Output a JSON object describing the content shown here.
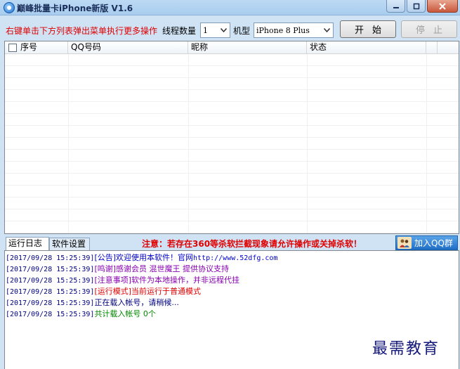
{
  "window": {
    "title": "巅峰批量卡iPhone新版 V1.6",
    "icon": "app-logo-icon"
  },
  "toolbar": {
    "hint": "右键单击下方列表弹出菜单执行更多操作",
    "threads_label": "线程数量",
    "threads_value": "1",
    "model_label": "机型",
    "model_value": "iPhone 8 Plus",
    "start_label": "开始",
    "stop_label": "停止"
  },
  "grid": {
    "columns": [
      "序号",
      "QQ号码",
      "昵称",
      "状态"
    ],
    "rows": []
  },
  "tabs": [
    "运行日志",
    "软件设置"
  ],
  "notice": "注意：若存在360等杀软拦截现象请允许操作或关掉杀软！",
  "qq_group_button": "加入QQ群",
  "log": [
    {
      "time": "[2017/09/28 15:25:39]",
      "tag": "[公告]",
      "text": "欢迎使用本软件！官网",
      "url": "http://www.52dfg.com",
      "color": "#0000cc"
    },
    {
      "time": "[2017/09/28 15:25:39]",
      "tag": "[鸣谢]",
      "text": "感谢会员 混世魔王 提供协议支持",
      "color": "#8800b0"
    },
    {
      "time": "[2017/09/28 15:25:39]",
      "tag": "[注意事项]",
      "text": "软件为本地操作，并非远程代挂",
      "color": "#8800b0"
    },
    {
      "time": "[2017/09/28 15:25:39]",
      "tag": "[运行模式]",
      "text": "当前运行于普通模式",
      "color": "#e00000"
    },
    {
      "time": "[2017/09/28 15:25:39]",
      "tag": "",
      "text": "正在载入帐号，请稍候...",
      "color": "#000080"
    },
    {
      "time": "[2017/09/28 15:25:39]",
      "tag": "",
      "text": "共计载入帐号 0个",
      "color": "#008800"
    }
  ],
  "watermark": "最需教育"
}
